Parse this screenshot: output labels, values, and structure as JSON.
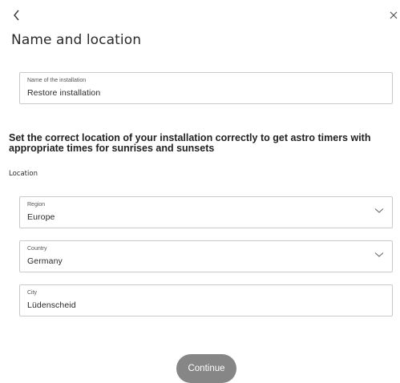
{
  "header": {
    "back_icon": "chevron-left-icon",
    "close_icon": "close-icon",
    "title": "Name and location"
  },
  "installation": {
    "label": "Name of the installation",
    "value": "Restore installation"
  },
  "info_text": "Set the correct location of your installation correctly to get astro timers with appropriate times for sunrises and sunsets",
  "location": {
    "section_label": "Location",
    "region": {
      "label": "Region",
      "value": "Europe",
      "icon": "chevron-down-icon"
    },
    "country": {
      "label": "Country",
      "value": "Germany",
      "icon": "chevron-down-icon"
    },
    "city": {
      "label": "City",
      "value": "Lüdenscheid"
    }
  },
  "footer": {
    "continue_label": "Continue"
  },
  "colors": {
    "button_bg": "#868686",
    "field_border": "#c9c9c9",
    "text": "#2a2a2a"
  }
}
